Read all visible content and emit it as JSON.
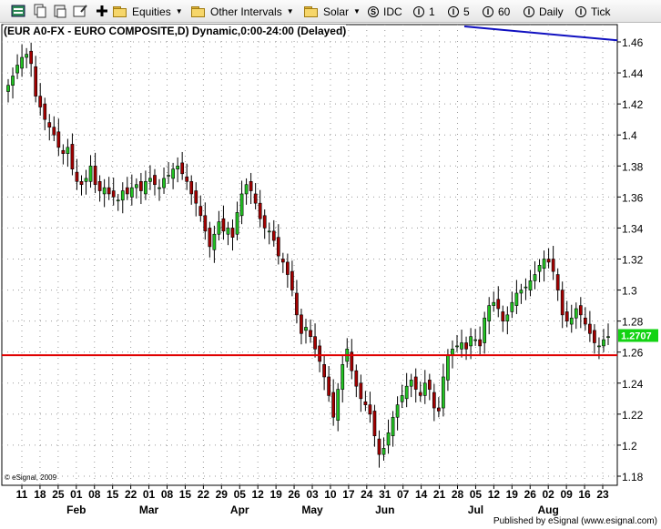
{
  "toolbar": {
    "equities_label": "Equities",
    "intervals_label": "Other Intervals",
    "solar_label": "Solar",
    "idc_label": "IDC",
    "i1_label": "1",
    "i5_label": "5",
    "i60_label": "60",
    "daily_label": "Daily",
    "tick_label": "Tick",
    "s_badge": "S",
    "i_badge": "I"
  },
  "chart": {
    "title": "(EUR A0-FX - EURO COMPOSITE,D) Dynamic,0:00-24:00 (Delayed)",
    "watermark": "© eSignal, 2009",
    "footer": "Published by eSignal (www.esignal.com)",
    "last_price_label": "1.2707"
  },
  "chart_data": {
    "type": "candlestick",
    "title": "(EUR A0-FX - EURO COMPOSITE,D) Dynamic,0:00-24:00 (Delayed)",
    "y_ticks": [
      "1.46",
      "1.44",
      "1.42",
      "1.4",
      "1.38",
      "1.36",
      "1.34",
      "1.32",
      "1.3",
      "1.28",
      "1.26",
      "1.24",
      "1.22",
      "1.2",
      "1.18"
    ],
    "ylim": [
      1.18,
      1.46
    ],
    "x_ticks": [
      "11",
      "18",
      "25",
      "01",
      "08",
      "15",
      "22",
      "01",
      "08",
      "15",
      "22",
      "29",
      "05",
      "12",
      "19",
      "26",
      "03",
      "10",
      "17",
      "24",
      "31",
      "07",
      "14",
      "21",
      "28",
      "05",
      "12",
      "19",
      "26",
      "02",
      "09",
      "16",
      "23"
    ],
    "month_labels": [
      "Feb",
      "Mar",
      "Apr",
      "May",
      "Jun",
      "Jul",
      "Aug"
    ],
    "horizontal_line": 1.258,
    "trendline": {
      "start": 1.47,
      "end": 1.461
    },
    "last_price": 1.2707,
    "closes": [
      1.432,
      1.438,
      1.445,
      1.45,
      1.452,
      1.446,
      1.425,
      1.418,
      1.41,
      1.405,
      1.4,
      1.392,
      1.388,
      1.392,
      1.378,
      1.37,
      1.368,
      1.372,
      1.38,
      1.368,
      1.364,
      1.366,
      1.362,
      1.36,
      1.358,
      1.364,
      1.362,
      1.366,
      1.368,
      1.364,
      1.37,
      1.372,
      1.368,
      1.366,
      1.372,
      1.374,
      1.378,
      1.38,
      1.375,
      1.37,
      1.362,
      1.356,
      1.348,
      1.338,
      1.328,
      1.336,
      1.344,
      1.338,
      1.34,
      1.334,
      1.35,
      1.362,
      1.368,
      1.364,
      1.356,
      1.346,
      1.34,
      1.338,
      1.332,
      1.322,
      1.318,
      1.31,
      1.3,
      1.284,
      1.272,
      1.276,
      1.27,
      1.262,
      1.254,
      1.244,
      1.232,
      1.218,
      1.236,
      1.252,
      1.262,
      1.248,
      1.238,
      1.23,
      1.226,
      1.22,
      1.206,
      1.194,
      1.198,
      1.208,
      1.218,
      1.226,
      1.232,
      1.238,
      1.242,
      1.236,
      1.232,
      1.24,
      1.236,
      1.224,
      1.222,
      1.244,
      1.258,
      1.262,
      1.264,
      1.266,
      1.262,
      1.27,
      1.268,
      1.264,
      1.282,
      1.29,
      1.292,
      1.288,
      1.28,
      1.284,
      1.292,
      1.298,
      1.3,
      1.302,
      1.306,
      1.31,
      1.316,
      1.32,
      1.318,
      1.312,
      1.3,
      1.284,
      1.28,
      1.282,
      1.288,
      1.284,
      1.278,
      1.272,
      1.266,
      1.264,
      1.268,
      1.27
    ]
  }
}
